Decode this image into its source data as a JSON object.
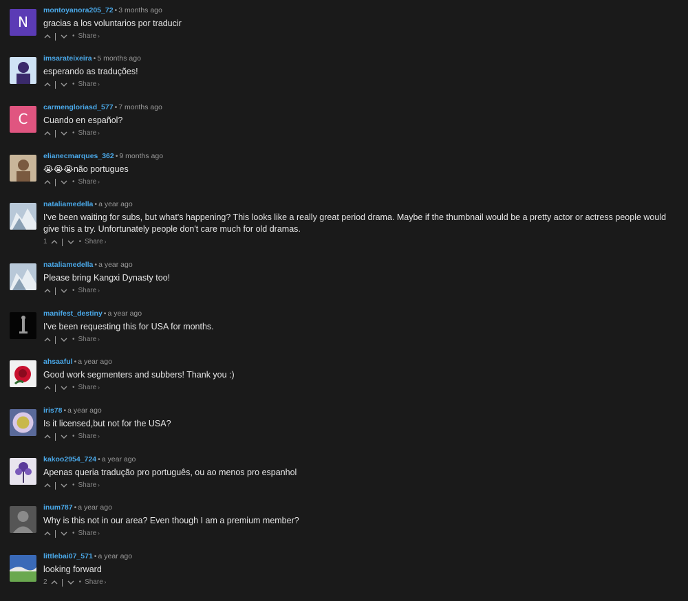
{
  "separator": "•",
  "share_label": "Share",
  "share_chevron": "›",
  "comments": [
    {
      "username": "montoyanora205_72",
      "time": "3 months ago",
      "text": "gracias a los voluntarios por traducir",
      "likes": "",
      "avatar": {
        "type": "letter",
        "letter": "N",
        "color": "#5b3bb5"
      }
    },
    {
      "username": "imsarateixeira",
      "time": "5 months ago",
      "text": "esperando as traduções!",
      "likes": "",
      "avatar": {
        "type": "image",
        "icon": "photo-avatar-icon",
        "colors": [
          "#cfe3f5",
          "#3a2a6b"
        ]
      }
    },
    {
      "username": "carmengloriasd_577",
      "time": "7 months ago",
      "text": "Cuando en español?",
      "likes": "",
      "avatar": {
        "type": "letter",
        "letter": "C",
        "color": "#e05580"
      }
    },
    {
      "username": "elianecmarques_362",
      "time": "9 months ago",
      "text": "😭😭😭não portugues",
      "likes": "",
      "avatar": {
        "type": "image",
        "icon": "photo-avatar-icon",
        "colors": [
          "#c9b69a",
          "#7a5a40"
        ]
      }
    },
    {
      "username": "nataliamedella",
      "time": "a year ago",
      "text": "I've been waiting for subs, but what's happening? This looks like a really great period drama. Maybe if the thumbnail would be a pretty actor or actress people would give this a try. Unfortunately people don't care much for old dramas.",
      "likes": "1",
      "avatar": {
        "type": "image",
        "icon": "mountain-avatar-icon",
        "colors": [
          "#b8c8d8",
          "#e8eef3"
        ]
      }
    },
    {
      "username": "nataliamedella",
      "time": "a year ago",
      "text": "Please bring Kangxi Dynasty too!",
      "likes": "",
      "avatar": {
        "type": "image",
        "icon": "mountain-avatar-icon",
        "colors": [
          "#b8c8d8",
          "#e8eef3"
        ]
      }
    },
    {
      "username": "manifest_destiny",
      "time": "a year ago",
      "text": "I've been requesting this for USA for months.",
      "likes": "",
      "avatar": {
        "type": "image",
        "icon": "statue-avatar-icon",
        "colors": [
          "#050505",
          "#9a9a9a"
        ]
      }
    },
    {
      "username": "ahsaaful",
      "time": "a year ago",
      "text": "Good work segmenters and subbers! Thank you :)",
      "likes": "",
      "avatar": {
        "type": "image",
        "icon": "rose-avatar-icon",
        "colors": [
          "#f2f2f2",
          "#c8102e"
        ]
      }
    },
    {
      "username": "iris78",
      "time": "a year ago",
      "text": "Is it licensed,but not for the USA?",
      "likes": "",
      "avatar": {
        "type": "image",
        "icon": "badge-avatar-icon",
        "colors": [
          "#5a6a9a",
          "#d8c8e8"
        ]
      }
    },
    {
      "username": "kakoo2954_724",
      "time": "a year ago",
      "text": "Apenas queria tradução pro português, ou ao menos pro espanhol",
      "likes": "",
      "avatar": {
        "type": "image",
        "icon": "flower-avatar-icon",
        "colors": [
          "#e8e4ee",
          "#5a3a9a"
        ]
      }
    },
    {
      "username": "inum787",
      "time": "a year ago",
      "text": "Why is this not in our area? Even though I am a premium member?",
      "likes": "",
      "avatar": {
        "type": "image",
        "icon": "default-user-avatar-icon",
        "colors": [
          "#555555",
          "#8a8a8a"
        ]
      }
    },
    {
      "username": "littlebai07_571",
      "time": "a year ago",
      "text": "looking forward",
      "likes": "2",
      "avatar": {
        "type": "image",
        "icon": "landscape-avatar-icon",
        "colors": [
          "#3a6ab8",
          "#6aa84f"
        ]
      }
    }
  ]
}
